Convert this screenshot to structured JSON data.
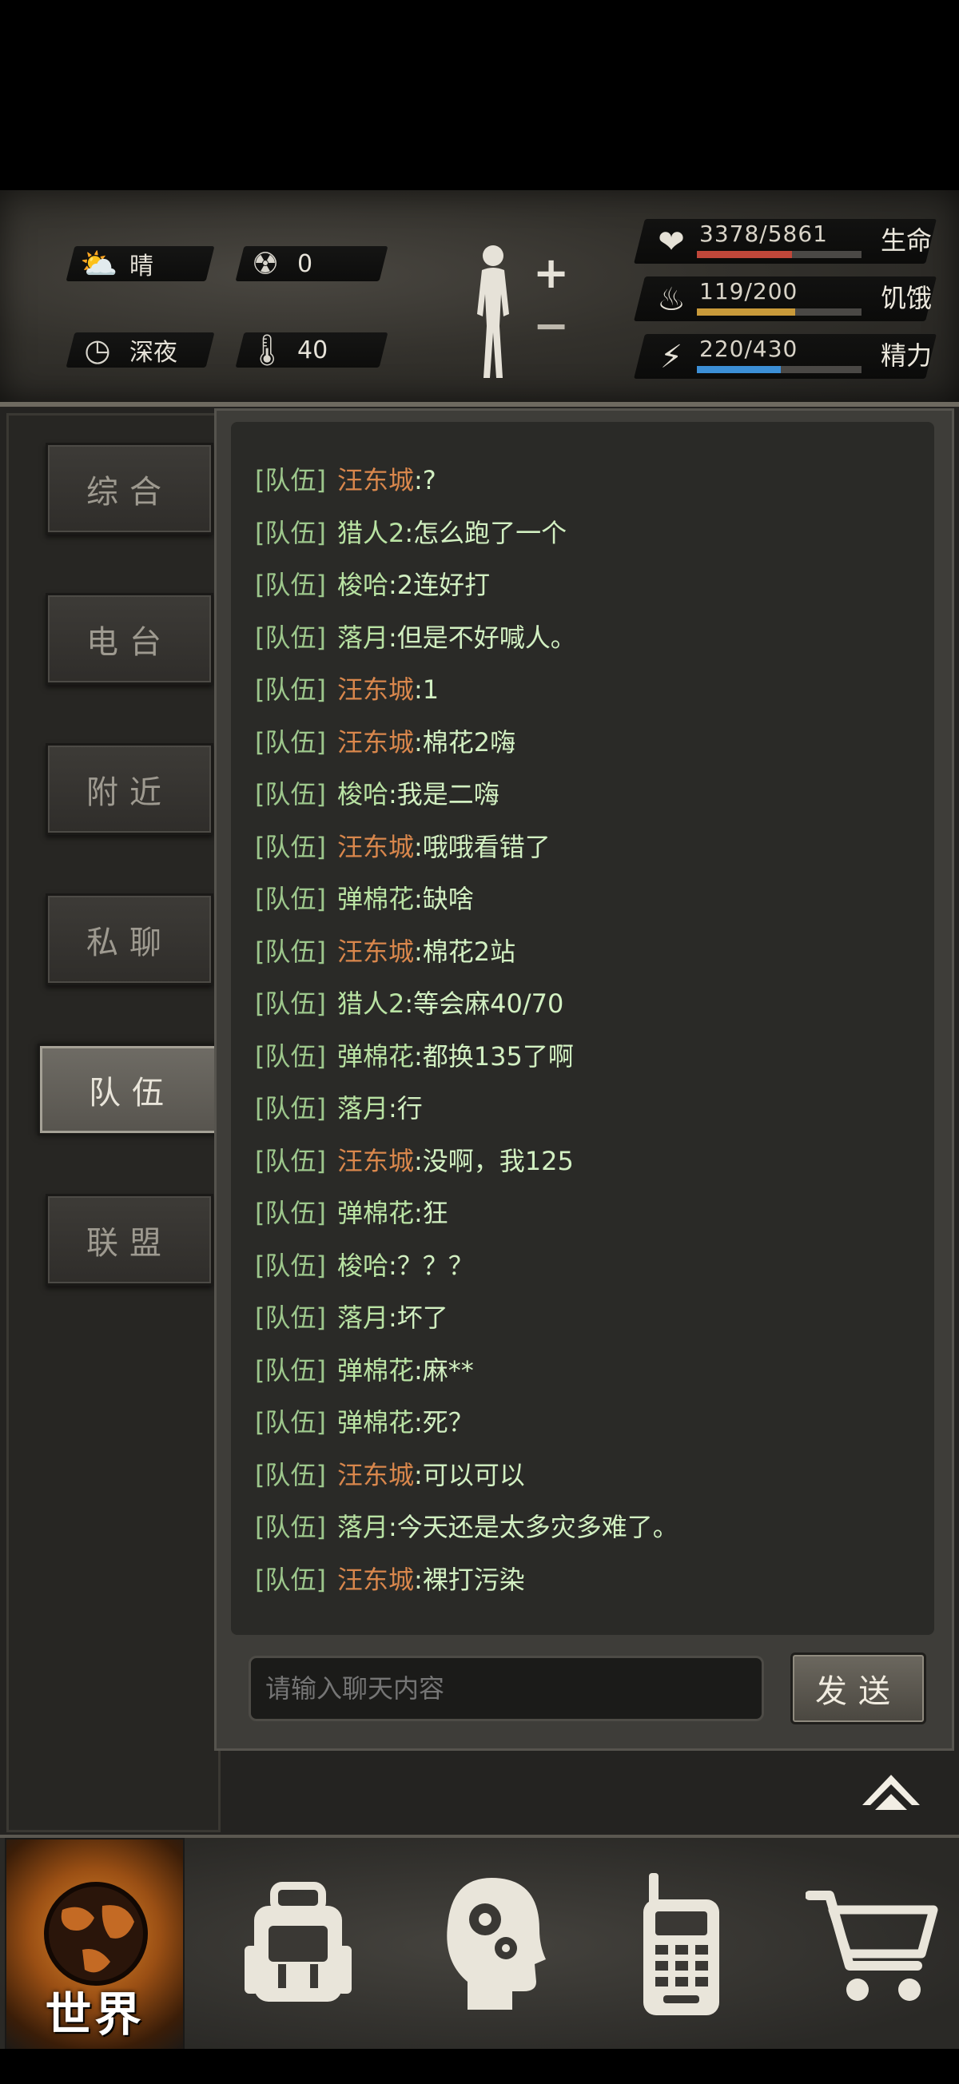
{
  "status": {
    "weather": {
      "icon": "partly-cloudy-icon",
      "label": "晴"
    },
    "radiation": {
      "icon": "radiation-icon",
      "value": "0"
    },
    "time": {
      "icon": "clock-icon",
      "label": "深夜"
    },
    "temperature": {
      "icon": "thermometer-icon",
      "value": "40"
    },
    "body_controls": {
      "plus": "+",
      "minus": "−"
    },
    "stats": [
      {
        "key": "health",
        "icon": "heart-pulse-icon",
        "value": "3378/5861",
        "label": "生命",
        "fraction": 0.576,
        "color": "#c0473a"
      },
      {
        "key": "hunger",
        "icon": "stomach-icon",
        "value": "119/200",
        "label": "饥饿",
        "fraction": 0.595,
        "color": "#c99a3a"
      },
      {
        "key": "energy",
        "icon": "energy-head-icon",
        "value": "220/430",
        "label": "精力",
        "fraction": 0.512,
        "color": "#3c8fd6"
      }
    ]
  },
  "tabs": [
    {
      "label": "综合",
      "active": false
    },
    {
      "label": "电台",
      "active": false
    },
    {
      "label": "附近",
      "active": false
    },
    {
      "label": "私聊",
      "active": false
    },
    {
      "label": "队伍",
      "active": true
    },
    {
      "label": "联盟",
      "active": false
    }
  ],
  "chat": {
    "messages": [
      {
        "channel": "[队伍]",
        "name": "汪东城",
        "name_color": "orange",
        "text": ":?"
      },
      {
        "channel": "[队伍]",
        "name": "猎人2",
        "name_color": "green",
        "text": ":怎么跑了一个"
      },
      {
        "channel": "[队伍]",
        "name": "梭哈",
        "name_color": "green",
        "text": ":2连好打"
      },
      {
        "channel": "[队伍]",
        "name": "落月",
        "name_color": "green",
        "text": ":但是不好喊人。"
      },
      {
        "channel": "[队伍]",
        "name": "汪东城",
        "name_color": "orange",
        "text": ":1"
      },
      {
        "channel": "[队伍]",
        "name": "汪东城",
        "name_color": "orange",
        "text": ":棉花2嗨"
      },
      {
        "channel": "[队伍]",
        "name": "梭哈",
        "name_color": "green",
        "text": ":我是二嗨"
      },
      {
        "channel": "[队伍]",
        "name": "汪东城",
        "name_color": "orange",
        "text": ":哦哦看错了"
      },
      {
        "channel": "[队伍]",
        "name": "弹棉花",
        "name_color": "green",
        "text": ":缺啥"
      },
      {
        "channel": "[队伍]",
        "name": "汪东城",
        "name_color": "orange",
        "text": ":棉花2站"
      },
      {
        "channel": "[队伍]",
        "name": "猎人2",
        "name_color": "green",
        "text": ":等会麻40/70"
      },
      {
        "channel": "[队伍]",
        "name": "弹棉花",
        "name_color": "green",
        "text": ":都换135了啊"
      },
      {
        "channel": "[队伍]",
        "name": "落月",
        "name_color": "green",
        "text": ":行"
      },
      {
        "channel": "[队伍]",
        "name": "汪东城",
        "name_color": "orange",
        "text": ":没啊，我125"
      },
      {
        "channel": "[队伍]",
        "name": "弹棉花",
        "name_color": "green",
        "text": ":狂"
      },
      {
        "channel": "[队伍]",
        "name": "梭哈",
        "name_color": "green",
        "text": ":？？？"
      },
      {
        "channel": "[队伍]",
        "name": "落月",
        "name_color": "green",
        "text": ":坏了"
      },
      {
        "channel": "[队伍]",
        "name": "弹棉花",
        "name_color": "green",
        "text": ":麻**"
      },
      {
        "channel": "[队伍]",
        "name": "弹棉花",
        "name_color": "green",
        "text": ":死？"
      },
      {
        "channel": "[队伍]",
        "name": "汪东城",
        "name_color": "orange",
        "text": ":可以可以"
      },
      {
        "channel": "[队伍]",
        "name": "落月",
        "name_color": "green",
        "text": ":今天还是太多灾多难了。"
      },
      {
        "channel": "[队伍]",
        "name": "汪东城",
        "name_color": "orange",
        "text": ":裸打污染"
      }
    ],
    "input_placeholder": "请输入聊天内容",
    "send_label": "发送"
  },
  "bottom_nav": [
    {
      "key": "world",
      "icon": "globe-icon",
      "label": "世界",
      "active": true
    },
    {
      "key": "inventory",
      "icon": "backpack-icon",
      "label": "",
      "active": false
    },
    {
      "key": "skills",
      "icon": "head-gears-icon",
      "label": "",
      "active": false
    },
    {
      "key": "radio",
      "icon": "walkie-talkie-icon",
      "label": "",
      "active": false
    },
    {
      "key": "shop",
      "icon": "cart-icon",
      "label": "",
      "active": false
    }
  ]
}
